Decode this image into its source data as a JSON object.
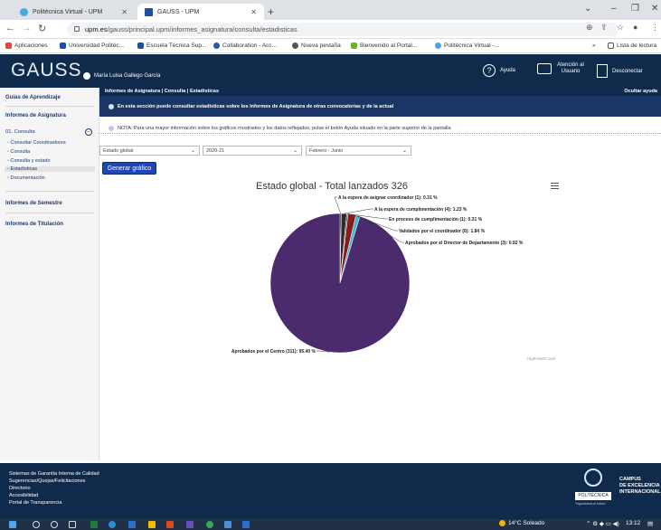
{
  "browser": {
    "tabs": [
      {
        "title": "Politécnica Virtual - UPM",
        "active": false
      },
      {
        "title": "GAUSS - UPM",
        "active": true
      }
    ],
    "new_tab": "+",
    "window_controls": [
      "⌄",
      "–",
      "❐",
      "✕"
    ],
    "url_host": "upm.es",
    "url_path": "/gauss/principal.upm/informes_asignatura/consulta/estadisticas",
    "bookmarks": [
      {
        "label": "Aplicaciones",
        "color": "#e04b3a"
      },
      {
        "label": "Universidad Politéc...",
        "color": "#1e4fa0"
      },
      {
        "label": "Escuela Técnica Sup...",
        "color": "#1e4fa0"
      },
      {
        "label": "Collaboration - Acc...",
        "color": "#2b579a"
      },
      {
        "label": "Nueva pestaña",
        "color": "#555555"
      },
      {
        "label": "Bienvenido al Portal...",
        "color": "#6fb02a"
      },
      {
        "label": "Politécnica Virtual -...",
        "color": "#4aa8e0"
      }
    ],
    "bookmarks_more": "»",
    "reading_list": "Lista de lectura"
  },
  "header": {
    "logo": "GAUSS",
    "user_name": "María Luisa Gallego García",
    "help_label": "Ayuda",
    "attention_label": "Atención al Usuario",
    "disconnect_label": "Desconectar"
  },
  "sidebar": {
    "guides": "Guías de Aprendizaje",
    "reports": "Informes de Asignatura",
    "consulta_title": "01. Consulta",
    "toggle": "–",
    "items": [
      {
        "label": "Consultar Coordinadores",
        "active": false
      },
      {
        "label": "Consulta",
        "active": false
      },
      {
        "label": "Consulta y estado",
        "active": false
      },
      {
        "label": "Estadísticas",
        "active": true
      },
      {
        "label": "Documentación",
        "active": false
      }
    ],
    "semester_reports": "Informes de Semestre",
    "degree_reports": "Informes de Titulación"
  },
  "main": {
    "breadcrumb": "Informes de Asignatura | Consulta | Estadísticas",
    "hide_help": "Ocultar ayuda",
    "info": "En esta sección puede consultar estadísticas sobre los Informes de Asignatura de otras convocatorias y de la actual",
    "note": "NOTA: Para una mayor información sobre los gráficos mostrados y los datos reflejados, pulse el botón Ayuda situado en la parte superior de la pantalla",
    "select_state": "Estado global",
    "select_year": "2020-21",
    "select_period": "Febrero - Junio",
    "generate_button": "Generar gráfico",
    "credit": "Highcharts.com"
  },
  "chart_data": {
    "type": "pie",
    "title": "Estado global - Total lanzados 326",
    "slices": [
      {
        "name": "A la espera de asignar coordinador",
        "count": 1,
        "value": 0.31,
        "color": "#111111",
        "label": "A la espera de asignar coordinador (1): 0.31 %"
      },
      {
        "name": "A la espera de cumplimentación",
        "count": 4,
        "value": 1.23,
        "color": "#2a2a2a",
        "label": "A la espera de cumplimentación (4): 1.23 %"
      },
      {
        "name": "En proceso de cumplimentación",
        "count": 1,
        "value": 0.31,
        "color": "#4a4a4a",
        "label": "En proceso de cumplimentación (1): 0.31 %"
      },
      {
        "name": "Validados por el coordinador",
        "count": 6,
        "value": 1.84,
        "color": "#8b1a1a",
        "label": "Validados por el coordinador (6): 1.84 %"
      },
      {
        "name": "Aprobados por el Director de Departamento",
        "count": 3,
        "value": 0.92,
        "color": "#3fb6d6",
        "label": "Aprobados por el Director de Departamento (3): 0.92 %"
      },
      {
        "name": "Aprobados por el Centro",
        "count": 311,
        "value": 95.4,
        "color": "#4b2a6e",
        "label": "Aprobados por el Centro (311): 95.40 %"
      }
    ]
  },
  "footer": {
    "links": [
      "Sistemas de Garantía Interna de Calidad",
      "Sugerencias/Quejas/Felicitaciones",
      "Directorio",
      "Accesibilidad",
      "Portal de Transparencia"
    ],
    "upm_badge": "POLITÉCNICA",
    "motto": "\"Ingeniamos el futuro\"",
    "campus_lines": [
      "CAMPUS",
      "DE EXCELENCIA",
      "INTERNACIONAL"
    ]
  },
  "taskbar": {
    "weather": "14°C  Soleado",
    "time": "13:12"
  }
}
